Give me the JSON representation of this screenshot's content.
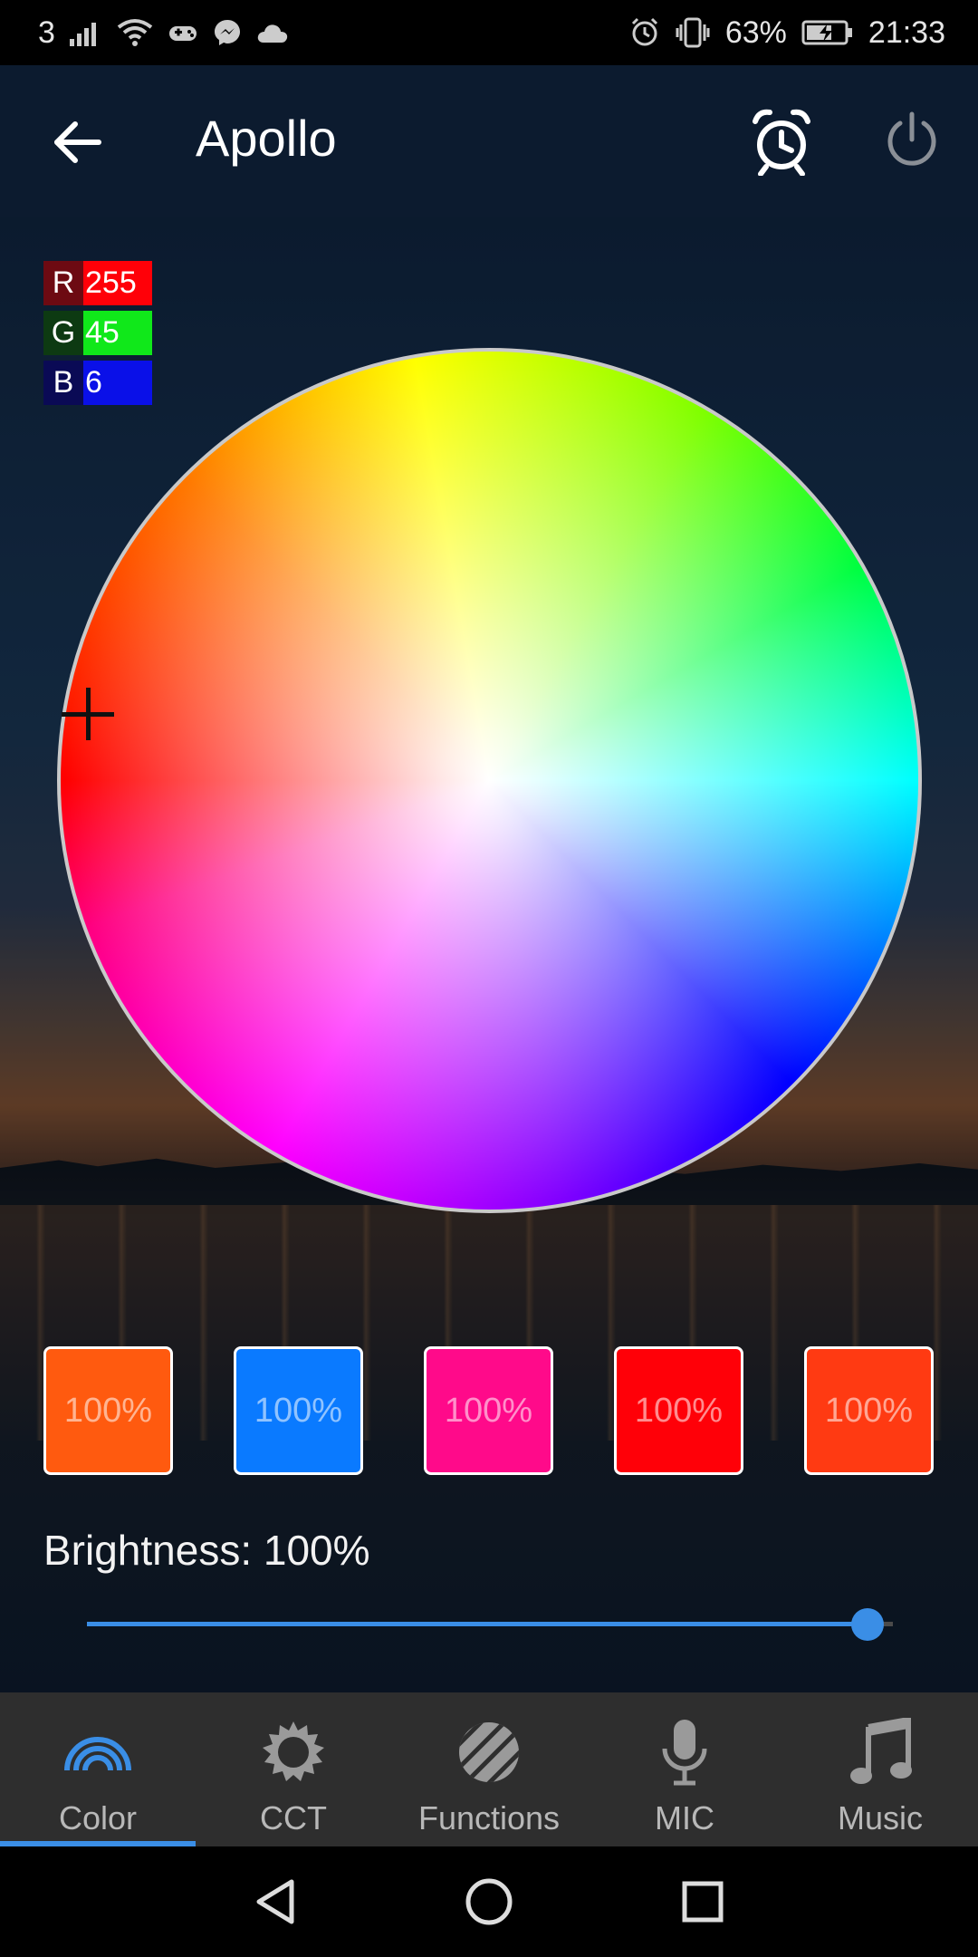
{
  "status_bar": {
    "carrier": "3",
    "battery": "63%",
    "time": "21:33"
  },
  "header": {
    "title": "Apollo"
  },
  "rgb": {
    "r_label": "R",
    "r_value": "255",
    "g_label": "G",
    "g_value": "45",
    "b_label": "B",
    "b_value": "6"
  },
  "presets": [
    {
      "label": "100%",
      "color": "#ff5a0f"
    },
    {
      "label": "100%",
      "color": "#0a7aff"
    },
    {
      "label": "100%",
      "color": "#ff0a8a"
    },
    {
      "label": "100%",
      "color": "#ff0008"
    },
    {
      "label": "100%",
      "color": "#ff3a12"
    }
  ],
  "brightness": {
    "label": "Brightness: 100%",
    "value": 1.0
  },
  "tabs": [
    {
      "label": "Color",
      "icon": "rainbow-icon",
      "active": true
    },
    {
      "label": "CCT",
      "icon": "sun-icon",
      "active": false
    },
    {
      "label": "Functions",
      "icon": "stripes-circle-icon",
      "active": false
    },
    {
      "label": "MIC",
      "icon": "microphone-icon",
      "active": false
    },
    {
      "label": "Music",
      "icon": "music-note-icon",
      "active": false
    }
  ],
  "colors": {
    "accent": "#3a8ee6",
    "tabbar_bg": "#2e2e2e",
    "header_bg": "#0c1b2f"
  }
}
